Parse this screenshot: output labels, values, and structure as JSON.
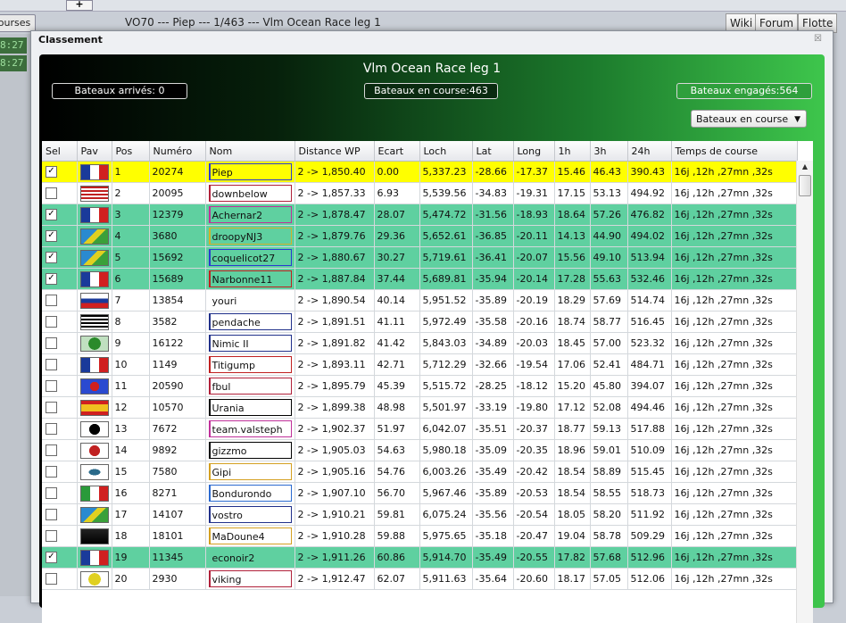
{
  "background": {
    "tab_courses": "ourses",
    "plus": "+",
    "title": "VO70 --- Piep --- 1/463 --- Vlm Ocean Race leg 1",
    "buttons": [
      "Wiki",
      "Forum",
      "Flotte"
    ],
    "clocks": [
      "8:27",
      "8:27"
    ]
  },
  "dialog": {
    "title": "Classement",
    "close": "☒"
  },
  "panel": {
    "race_title": "Vlm Ocean Race leg 1",
    "arrived": "Bateaux arrivés: 0",
    "racing": "Bateaux en course:463",
    "engaged": "Bateaux engagés:564",
    "filter": "Bateaux en course"
  },
  "table": {
    "columns": [
      "Sel",
      "Pav",
      "Pos",
      "Numéro",
      "Nom",
      "Distance WP",
      "Ecart",
      "Loch",
      "Lat",
      "Long",
      "1h",
      "3h",
      "24h",
      "Temps de course"
    ],
    "rows": [
      {
        "sel": true,
        "state": "first",
        "pos": "1",
        "num": "20274",
        "name": "Piep",
        "dist": "2 -> 1,850.40",
        "ecart": "0.00",
        "loch": "5,337.23",
        "lat": "-28.66",
        "long": "-17.37",
        "h1": "15.46",
        "h3": "46.43",
        "h24": "390.43",
        "time": "16j ,12h ,27mn ,32s",
        "color": "#2a3ad0"
      },
      {
        "sel": false,
        "state": "",
        "pos": "2",
        "num": "20095",
        "name": "downbelow",
        "dist": "2 -> 1,857.33",
        "ecart": "6.93",
        "loch": "5,539.56",
        "lat": "-34.83",
        "long": "-19.31",
        "h1": "17.15",
        "h3": "53.13",
        "h24": "494.92",
        "time": "16j ,12h ,27mn ,32s",
        "color": "#b0203a"
      },
      {
        "sel": true,
        "state": "sel",
        "pos": "3",
        "num": "12379",
        "name": "Achernar2",
        "dist": "2 -> 1,878.47",
        "ecart": "28.07",
        "loch": "5,474.72",
        "lat": "-31.56",
        "long": "-18.93",
        "h1": "18.64",
        "h3": "57.26",
        "h24": "476.82",
        "time": "16j ,12h ,27mn ,32s",
        "color": "#c0309a"
      },
      {
        "sel": true,
        "state": "sel",
        "pos": "4",
        "num": "3680",
        "name": "droopyNJ3",
        "dist": "2 -> 1,879.76",
        "ecart": "29.36",
        "loch": "5,652.61",
        "lat": "-36.85",
        "long": "-20.11",
        "h1": "14.13",
        "h3": "44.90",
        "h24": "494.02",
        "time": "16j ,12h ,27mn ,32s",
        "color": "#d4b028"
      },
      {
        "sel": true,
        "state": "sel",
        "pos": "5",
        "num": "15692",
        "name": "coquelicot27",
        "dist": "2 -> 1,880.67",
        "ecart": "30.27",
        "loch": "5,719.61",
        "lat": "-36.41",
        "long": "-20.07",
        "h1": "15.56",
        "h3": "49.10",
        "h24": "513.94",
        "time": "16j ,12h ,27mn ,32s",
        "color": "#2a3ad0"
      },
      {
        "sel": true,
        "state": "sel",
        "pos": "6",
        "num": "15689",
        "name": "Narbonne11",
        "dist": "2 -> 1,887.84",
        "ecart": "37.44",
        "loch": "5,689.81",
        "lat": "-35.94",
        "long": "-20.14",
        "h1": "17.28",
        "h3": "55.63",
        "h24": "532.46",
        "time": "16j ,12h ,27mn ,32s",
        "color": "#c02020"
      },
      {
        "sel": false,
        "state": "",
        "pos": "7",
        "num": "13854",
        "name": "youri",
        "dist": "2 -> 1,890.54",
        "ecart": "40.14",
        "loch": "5,951.52",
        "lat": "-35.89",
        "long": "-20.19",
        "h1": "18.29",
        "h3": "57.69",
        "h24": "514.74",
        "time": "16j ,12h ,27mn ,32s",
        "color": "#ffffff"
      },
      {
        "sel": false,
        "state": "",
        "pos": "8",
        "num": "3582",
        "name": "pendache",
        "dist": "2 -> 1,891.51",
        "ecart": "41.11",
        "loch": "5,972.49",
        "lat": "-35.58",
        "long": "-20.16",
        "h1": "18.74",
        "h3": "58.77",
        "h24": "516.45",
        "time": "16j ,12h ,27mn ,32s",
        "color": "#20308a"
      },
      {
        "sel": false,
        "state": "",
        "pos": "9",
        "num": "16122",
        "name": "Nimic II",
        "dist": "2 -> 1,891.82",
        "ecart": "41.42",
        "loch": "5,843.03",
        "lat": "-34.89",
        "long": "-20.03",
        "h1": "18.45",
        "h3": "57.00",
        "h24": "523.32",
        "time": "16j ,12h ,27mn ,32s",
        "color": "#20308a"
      },
      {
        "sel": false,
        "state": "",
        "pos": "10",
        "num": "1149",
        "name": "Titigump",
        "dist": "2 -> 1,893.11",
        "ecart": "42.71",
        "loch": "5,712.29",
        "lat": "-32.66",
        "long": "-19.54",
        "h1": "17.06",
        "h3": "52.41",
        "h24": "484.71",
        "time": "16j ,12h ,27mn ,32s",
        "color": "#c02020"
      },
      {
        "sel": false,
        "state": "",
        "pos": "11",
        "num": "20590",
        "name": "fbul",
        "dist": "2 -> 1,895.79",
        "ecart": "45.39",
        "loch": "5,515.72",
        "lat": "-28.25",
        "long": "-18.12",
        "h1": "15.20",
        "h3": "45.80",
        "h24": "394.07",
        "time": "16j ,12h ,27mn ,32s",
        "color": "#b0203a"
      },
      {
        "sel": false,
        "state": "",
        "pos": "12",
        "num": "10570",
        "name": "Urania",
        "dist": "2 -> 1,899.38",
        "ecart": "48.98",
        "loch": "5,501.97",
        "lat": "-33.19",
        "long": "-19.80",
        "h1": "17.12",
        "h3": "52.08",
        "h24": "494.46",
        "time": "16j ,12h ,27mn ,32s",
        "color": "#000000"
      },
      {
        "sel": false,
        "state": "",
        "pos": "13",
        "num": "7672",
        "name": "team.valsteph",
        "dist": "2 -> 1,902.37",
        "ecart": "51.97",
        "loch": "6,042.07",
        "lat": "-35.51",
        "long": "-20.37",
        "h1": "18.77",
        "h3": "59.13",
        "h24": "517.88",
        "time": "16j ,12h ,27mn ,32s",
        "color": "#c0309a"
      },
      {
        "sel": false,
        "state": "",
        "pos": "14",
        "num": "9892",
        "name": "gizzmo",
        "dist": "2 -> 1,905.03",
        "ecart": "54.63",
        "loch": "5,980.18",
        "lat": "-35.09",
        "long": "-20.35",
        "h1": "18.96",
        "h3": "59.01",
        "h24": "510.09",
        "time": "16j ,12h ,27mn ,32s",
        "color": "#000000"
      },
      {
        "sel": false,
        "state": "",
        "pos": "15",
        "num": "7580",
        "name": "Gipi",
        "dist": "2 -> 1,905.16",
        "ecart": "54.76",
        "loch": "6,003.26",
        "lat": "-35.49",
        "long": "-20.42",
        "h1": "18.54",
        "h3": "58.89",
        "h24": "515.45",
        "time": "16j ,12h ,27mn ,32s",
        "color": "#d4a020"
      },
      {
        "sel": false,
        "state": "",
        "pos": "16",
        "num": "8271",
        "name": "Bondurondo",
        "dist": "2 -> 1,907.10",
        "ecart": "56.70",
        "loch": "5,967.46",
        "lat": "-35.89",
        "long": "-20.53",
        "h1": "18.54",
        "h3": "58.55",
        "h24": "518.73",
        "time": "16j ,12h ,27mn ,32s",
        "color": "#2a6ad0"
      },
      {
        "sel": false,
        "state": "",
        "pos": "17",
        "num": "14107",
        "name": "vostro",
        "dist": "2 -> 1,910.21",
        "ecart": "59.81",
        "loch": "6,075.24",
        "lat": "-35.56",
        "long": "-20.54",
        "h1": "18.05",
        "h3": "58.20",
        "h24": "511.92",
        "time": "16j ,12h ,27mn ,32s",
        "color": "#20308a"
      },
      {
        "sel": false,
        "state": "",
        "pos": "18",
        "num": "18101",
        "name": "MaDoune4",
        "dist": "2 -> 1,910.28",
        "ecart": "59.88",
        "loch": "5,975.65",
        "lat": "-35.18",
        "long": "-20.47",
        "h1": "19.04",
        "h3": "58.78",
        "h24": "509.29",
        "time": "16j ,12h ,27mn ,32s",
        "color": "#d4a020"
      },
      {
        "sel": true,
        "state": "sel",
        "pos": "19",
        "num": "11345",
        "name": "econoir2",
        "dist": "2 -> 1,911.26",
        "ecart": "60.86",
        "loch": "5,914.70",
        "lat": "-35.49",
        "long": "-20.55",
        "h1": "17.82",
        "h3": "57.68",
        "h24": "512.96",
        "time": "16j ,12h ,27mn ,32s",
        "color": "#5fd0a0"
      },
      {
        "sel": false,
        "state": "",
        "pos": "20",
        "num": "2930",
        "name": "viking",
        "dist": "2 -> 1,912.47",
        "ecart": "62.07",
        "loch": "5,911.63",
        "lat": "-35.64",
        "long": "-20.60",
        "h1": "18.17",
        "h3": "57.05",
        "h24": "512.06",
        "time": "16j ,12h ,27mn ,32s",
        "color": "#b0203a"
      }
    ]
  }
}
